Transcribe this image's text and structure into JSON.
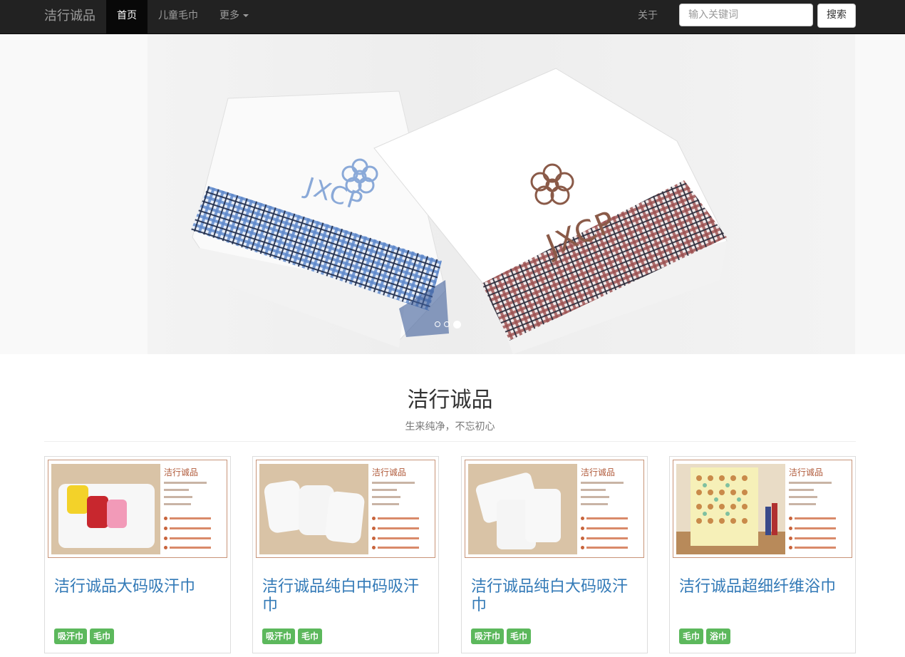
{
  "navbar": {
    "brand": "洁行诚品",
    "items": [
      {
        "label": "首页",
        "active": true
      },
      {
        "label": "儿童毛巾",
        "active": false
      },
      {
        "label": "更多",
        "active": false,
        "dropdown": true
      }
    ],
    "about": "关于",
    "search_placeholder": "输入关键词",
    "search_button": "搜索"
  },
  "carousel": {
    "slide_count": 3,
    "active_slide": 3,
    "towel_label": "JXCP"
  },
  "header": {
    "title": "洁行诚品",
    "subtitle": "生来纯净，不忘初心"
  },
  "products": [
    {
      "title": "洁行诚品大码吸汗巾",
      "thumb_brand": "洁行诚品",
      "tags": [
        "吸汗巾",
        "毛巾"
      ]
    },
    {
      "title": "洁行诚品纯白中码吸汗巾",
      "thumb_brand": "洁行诚品",
      "tags": [
        "吸汗巾",
        "毛巾"
      ]
    },
    {
      "title": "洁行诚品纯白大码吸汗巾",
      "thumb_brand": "洁行诚品",
      "tags": [
        "吸汗巾",
        "毛巾"
      ]
    },
    {
      "title": "洁行诚品超细纤维浴巾",
      "thumb_brand": "洁行诚品",
      "tags": [
        "毛巾",
        "浴巾"
      ]
    }
  ],
  "colors": {
    "navbar_bg": "#222222",
    "link": "#337ab7",
    "tag_green": "#5cb85c",
    "thumb_accent": "#b05a3a"
  }
}
